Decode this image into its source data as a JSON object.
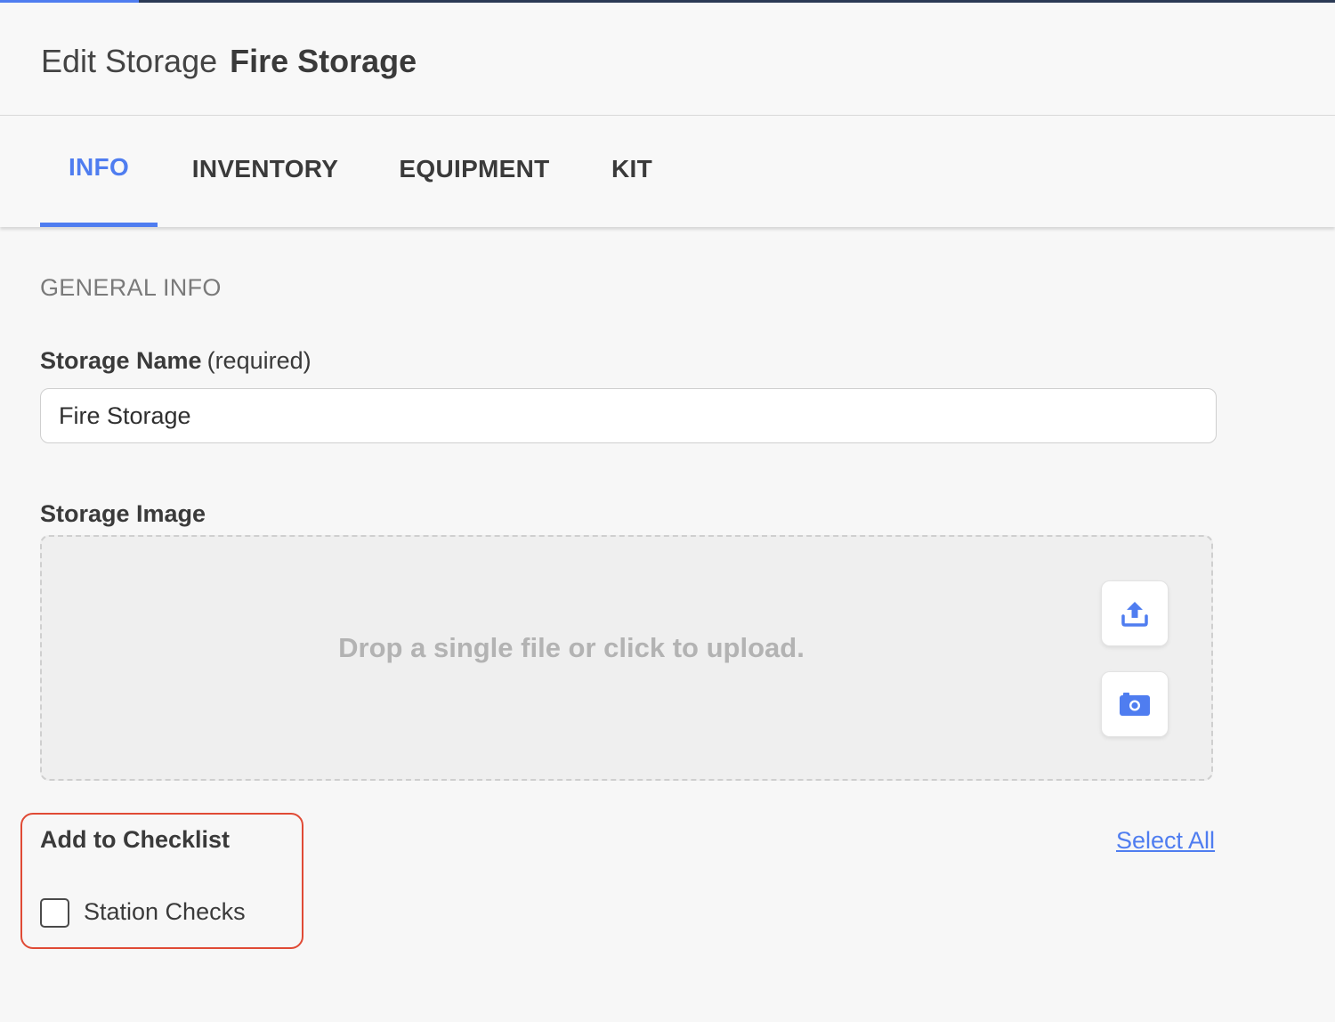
{
  "header": {
    "title_prefix": "Edit Storage",
    "title_name": "Fire Storage"
  },
  "tabs": [
    {
      "label": "INFO",
      "active": true
    },
    {
      "label": "INVENTORY",
      "active": false
    },
    {
      "label": "EQUIPMENT",
      "active": false
    },
    {
      "label": "KIT",
      "active": false
    }
  ],
  "general_info": {
    "section_label": "GENERAL INFO",
    "storage_name": {
      "label": "Storage Name",
      "hint": "(required)",
      "value": "Fire Storage"
    },
    "storage_image": {
      "label": "Storage Image",
      "dropzone_text": "Drop a single file or click to upload.",
      "upload_icon": "upload-icon",
      "camera_icon": "camera-icon"
    }
  },
  "checklist": {
    "title": "Add to Checklist",
    "select_all_label": "Select All",
    "items": [
      {
        "label": "Station Checks",
        "checked": false
      }
    ]
  },
  "colors": {
    "accent": "#4f7df0",
    "highlight_border": "#e04a35",
    "background": "#f7f7f7"
  }
}
